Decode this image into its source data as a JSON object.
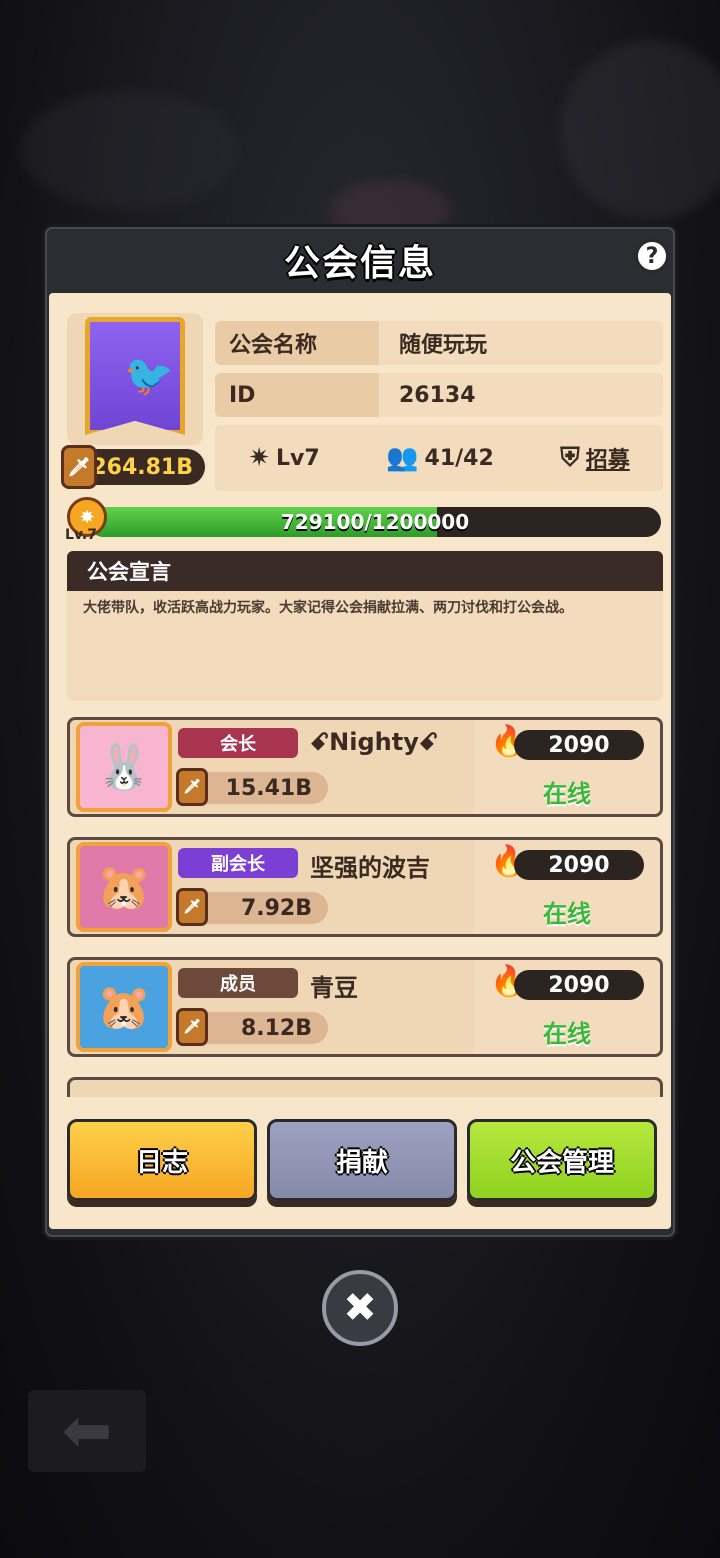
{
  "dialog": {
    "title": "公会信息",
    "help": "?"
  },
  "guild": {
    "name_label": "公会名称",
    "name_value": "随便玩玩",
    "id_label": "ID",
    "id_value": "26134",
    "total_power": "264.81B",
    "level": "Lv7",
    "members": "41/42",
    "recruit": "招募",
    "exp_current": 729100,
    "exp_max": 1200000,
    "exp_text": "729100/1200000",
    "level_badge_text": "Lv.7"
  },
  "announcement": {
    "title": "公会宣言",
    "text": "大佬带队，收活跃高战力玩家。大家记得公会捐献拉满、两刀讨伐和打公会战。"
  },
  "members": [
    {
      "role": "会长",
      "role_color": "#a8344f",
      "name": "ꗃNightyꗃ",
      "power": "15.41B",
      "activity": "2090",
      "status": "在线",
      "avatar": "🐰",
      "avatar_bg": "#f8b5cf"
    },
    {
      "role": "副会长",
      "role_color": "#7b3fd6",
      "name": "坚强的波吉",
      "power": "7.92B",
      "activity": "2090",
      "status": "在线",
      "avatar": "🐹",
      "avatar_bg": "#e07aa8"
    },
    {
      "role": "成员",
      "role_color": "#6e4a3c",
      "name": "青豆",
      "power": "8.12B",
      "activity": "2090",
      "status": "在线",
      "avatar": "🐹",
      "avatar_bg": "#4aa3e0"
    }
  ],
  "buttons": {
    "log": "日志",
    "donate": "捐献",
    "manage": "公会管理"
  },
  "close": "✖",
  "back": "⬅"
}
